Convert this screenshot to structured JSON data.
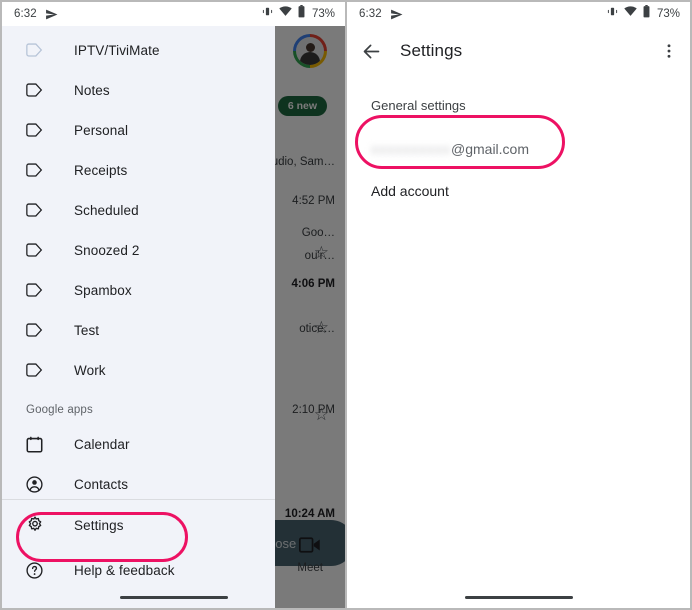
{
  "status_bar": {
    "time": "6:32",
    "battery_percent": "73%",
    "icons": [
      "send-icon",
      "vibrate-icon",
      "wifi-icon",
      "battery-icon"
    ]
  },
  "left_panel": {
    "drawer": {
      "labels": [
        {
          "icon": "label-icon",
          "label": "IPTV/TiviMate",
          "faded": true
        },
        {
          "icon": "label-icon",
          "label": "Notes",
          "faded": false
        },
        {
          "icon": "label-icon",
          "label": "Personal",
          "faded": false
        },
        {
          "icon": "label-icon",
          "label": "Receipts",
          "faded": false
        },
        {
          "icon": "label-icon",
          "label": "Scheduled",
          "faded": false
        },
        {
          "icon": "label-icon",
          "label": "Snoozed 2",
          "faded": false
        },
        {
          "icon": "label-icon",
          "label": "Spambox",
          "faded": false
        },
        {
          "icon": "label-icon",
          "label": "Test",
          "faded": false
        },
        {
          "icon": "label-icon",
          "label": "Work",
          "faded": false
        }
      ],
      "section_header": "Google apps",
      "google_apps": [
        {
          "icon": "calendar-icon",
          "label": "Calendar"
        },
        {
          "icon": "contacts-icon",
          "label": "Contacts"
        }
      ],
      "footer": [
        {
          "icon": "gear-icon",
          "label": "Settings",
          "highlighted": true
        },
        {
          "icon": "help-icon",
          "label": "Help & feedback",
          "highlighted": false
        }
      ]
    },
    "background_mail": {
      "badge": "6 new",
      "rows": [
        {
          "text": "studio, Sam…",
          "bold": false,
          "top": "130"
        },
        {
          "text": "4:52 PM",
          "bold": false,
          "top": "169"
        },
        {
          "text": "Goo…",
          "bold": false,
          "top": "201"
        },
        {
          "text": "ou'r…",
          "bold": false,
          "top": "224"
        },
        {
          "text": "4:06 PM",
          "bold": true,
          "top": "252"
        },
        {
          "text": "otice…",
          "bold": false,
          "top": "297"
        },
        {
          "text": "2:10 PM",
          "bold": false,
          "top": "378"
        },
        {
          "text": "10:24 AM",
          "bold": true,
          "top": "482"
        }
      ],
      "compose_label": "ompose",
      "meet_label": "Meet",
      "meet_icon": "video-camera-icon"
    }
  },
  "right_panel": {
    "appbar": {
      "back_icon": "back-arrow-icon",
      "title": "Settings",
      "overflow_icon": "more-vertical-icon"
    },
    "section_label": "General settings",
    "account": {
      "redacted_user": "xxxxxxxxxx",
      "domain": "@gmail.com",
      "highlighted": true
    },
    "add_account": "Add account"
  },
  "highlight_color": "#ed1163"
}
